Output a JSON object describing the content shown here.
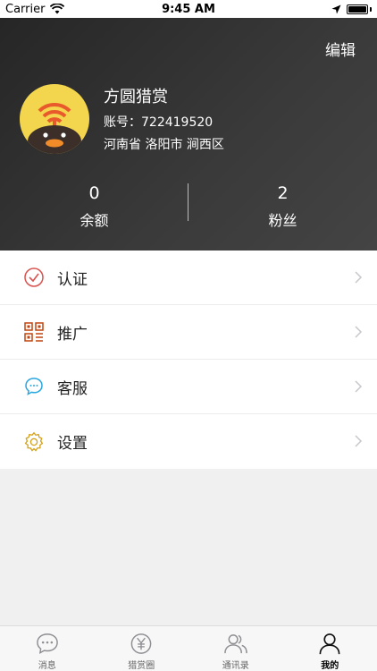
{
  "status_bar": {
    "carrier": "Carrier",
    "time": "9:45 AM"
  },
  "header": {
    "edit_label": "编辑",
    "name": "方圆猎赏",
    "account_label": "账号：",
    "account_id": "722419520",
    "location": "河南省 洛阳市 涧西区",
    "stats": [
      {
        "value": "0",
        "label": "余额"
      },
      {
        "value": "2",
        "label": "粉丝"
      }
    ]
  },
  "menu": {
    "items": [
      {
        "label": "认证",
        "icon": "verify-check-icon",
        "color": "#d9534f"
      },
      {
        "label": "推广",
        "icon": "qrcode-icon",
        "color": "#c1440e"
      },
      {
        "label": "客服",
        "icon": "chat-bubble-icon",
        "color": "#2aa7e0"
      },
      {
        "label": "设置",
        "icon": "gear-icon",
        "color": "#d4a017"
      }
    ]
  },
  "tabbar": {
    "tabs": [
      {
        "label": "消息",
        "icon": "message-bubble-icon"
      },
      {
        "label": "猎赏圈",
        "icon": "yen-circle-icon"
      },
      {
        "label": "通讯录",
        "icon": "contacts-icon"
      },
      {
        "label": "我的",
        "icon": "person-icon"
      }
    ],
    "active_index": 3
  }
}
